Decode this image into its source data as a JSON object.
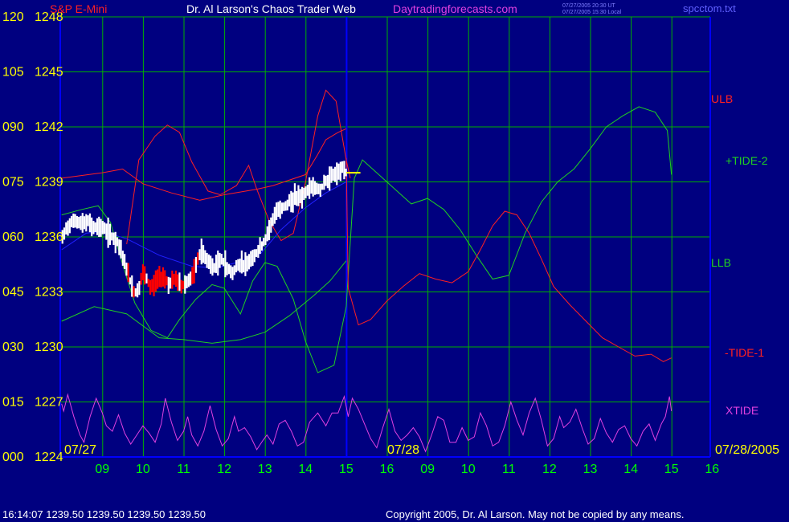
{
  "header": {
    "instrument": "S&P E-Mini",
    "title": "Dr. Al Larson's Chaos Trader Web",
    "site": "Daytradingforecasts.com",
    "stamp_ut": "07/27/2005 20:30 UT",
    "stamp_local": "07/27/2005 15:30 Local",
    "file": "spcctom.txt"
  },
  "footer": {
    "status": "16:14:07  1239.50 1239.50 1239.50 1239.50",
    "copyright": "Copyright 2005, Dr. Al Larson. May not be copied by any means."
  },
  "colors": {
    "background": "#000080",
    "grid": "#00b000",
    "axis": "#0000ff",
    "price_bar": "#ffffff",
    "price_bar_low": "#ff0000",
    "ulb": "#ff2020",
    "llb": "#20d020",
    "tide_plus": "#20d020",
    "tide_minus": "#ff2020",
    "xtide": "#e040e0",
    "moving_avg": "#2020ff",
    "yellow": "#ffff00"
  },
  "chart_data": {
    "type": "line",
    "y_left_labels": [
      "120",
      "105",
      "090",
      "075",
      "060",
      "045",
      "030",
      "015",
      "000"
    ],
    "y_price_labels": [
      "1248",
      "1245",
      "1242",
      "1239",
      "1236",
      "1233",
      "1230",
      "1227",
      "1224"
    ],
    "ylim_price": [
      1224,
      1248
    ],
    "x_hour_labels": [
      "09",
      "10",
      "11",
      "12",
      "13",
      "14",
      "15",
      "16",
      "09",
      "10",
      "11",
      "12",
      "13",
      "14",
      "15",
      "16"
    ],
    "date_labels": [
      "07/27",
      "07/28",
      "07/28/2005"
    ],
    "series_labels": {
      "ulb": "ULB",
      "tide_plus": "+TIDE-2",
      "llb": "LLB",
      "tide_minus": "-TIDE-1",
      "xtide": "XTIDE"
    },
    "last_price": 1239.5,
    "ulb": [
      [
        0,
        1239.2
      ],
      [
        1,
        1239.5
      ],
      [
        1.5,
        1239.7
      ],
      [
        2,
        1238.9
      ],
      [
        2.7,
        1238.4
      ],
      [
        3.4,
        1238.0
      ],
      [
        4,
        1238.3
      ],
      [
        4.8,
        1238.6
      ],
      [
        5.2,
        1238.8
      ],
      [
        6,
        1239.4
      ],
      [
        6.3,
        1240.5
      ],
      [
        6.5,
        1241.3
      ],
      [
        6.8,
        1241.7
      ],
      [
        7,
        1241.9
      ]
    ],
    "ulb_upper": [
      [
        1.6,
        1235.6
      ],
      [
        1.9,
        1240.2
      ],
      [
        2.3,
        1241.5
      ],
      [
        2.6,
        1242.1
      ],
      [
        2.9,
        1241.7
      ],
      [
        3.2,
        1240.1
      ],
      [
        3.6,
        1238.5
      ],
      [
        3.9,
        1238.3
      ],
      [
        4.3,
        1238.8
      ],
      [
        4.6,
        1239.9
      ],
      [
        4.8,
        1238.6
      ],
      [
        5.1,
        1236.9
      ],
      [
        5.4,
        1235.8
      ],
      [
        5.7,
        1236.2
      ],
      [
        6,
        1239.0
      ],
      [
        6.3,
        1242.6
      ],
      [
        6.5,
        1244.0
      ],
      [
        6.75,
        1243.4
      ],
      [
        7,
        1240.2
      ],
      [
        7.1,
        1239.2
      ]
    ],
    "llb": [
      [
        0,
        1231.4
      ],
      [
        0.8,
        1232.2
      ],
      [
        1.6,
        1231.8
      ],
      [
        2.4,
        1230.5
      ],
      [
        3,
        1230.4
      ],
      [
        3.7,
        1230.2
      ],
      [
        4.4,
        1230.4
      ],
      [
        5,
        1230.8
      ],
      [
        5.6,
        1231.7
      ],
      [
        6.2,
        1232.8
      ],
      [
        6.6,
        1233.6
      ],
      [
        7,
        1234.7
      ]
    ],
    "tide_plus": [
      [
        0,
        1237.2
      ],
      [
        0.5,
        1237.5
      ],
      [
        0.9,
        1237.7
      ],
      [
        1.2,
        1236.8
      ],
      [
        1.5,
        1234.5
      ],
      [
        1.8,
        1232.4
      ],
      [
        2.2,
        1230.9
      ],
      [
        2.6,
        1230.5
      ],
      [
        2.9,
        1231.5
      ],
      [
        3.3,
        1232.6
      ],
      [
        3.7,
        1233.4
      ],
      [
        4,
        1233.2
      ],
      [
        4.4,
        1231.8
      ],
      [
        4.7,
        1233.6
      ],
      [
        5,
        1234.6
      ],
      [
        5.3,
        1234.4
      ],
      [
        5.7,
        1232.6
      ],
      [
        6,
        1230.3
      ],
      [
        6.3,
        1228.6
      ],
      [
        6.7,
        1229.0
      ],
      [
        7,
        1232.2
      ],
      [
        7.2,
        1239.2
      ],
      [
        7.4,
        1240.2
      ],
      [
        7.8,
        1239.4
      ],
      [
        8.2,
        1238.6
      ],
      [
        8.6,
        1237.8
      ],
      [
        9,
        1238.1
      ],
      [
        9.4,
        1237.5
      ],
      [
        9.8,
        1236.4
      ],
      [
        10.2,
        1235.0
      ],
      [
        10.6,
        1233.7
      ],
      [
        11,
        1233.9
      ],
      [
        11.4,
        1236.2
      ],
      [
        11.8,
        1237.9
      ],
      [
        12.2,
        1239.0
      ],
      [
        12.6,
        1239.7
      ],
      [
        13,
        1240.8
      ],
      [
        13.4,
        1242.0
      ],
      [
        13.8,
        1242.6
      ],
      [
        14.2,
        1243.1
      ],
      [
        14.6,
        1242.8
      ],
      [
        14.9,
        1241.8
      ],
      [
        15,
        1239.4
      ]
    ],
    "tide_minus": [
      [
        7,
        1240.3
      ],
      [
        7.05,
        1233.2
      ],
      [
        7.3,
        1231.2
      ],
      [
        7.6,
        1231.5
      ],
      [
        8,
        1232.5
      ],
      [
        8.4,
        1233.3
      ],
      [
        8.8,
        1234.0
      ],
      [
        9.2,
        1233.7
      ],
      [
        9.6,
        1233.5
      ],
      [
        10,
        1234.1
      ],
      [
        10.3,
        1235.3
      ],
      [
        10.6,
        1236.6
      ],
      [
        10.9,
        1237.4
      ],
      [
        11.2,
        1237.2
      ],
      [
        11.5,
        1236.2
      ],
      [
        11.8,
        1234.8
      ],
      [
        12.1,
        1233.3
      ],
      [
        12.5,
        1232.3
      ],
      [
        12.9,
        1231.4
      ],
      [
        13.3,
        1230.5
      ],
      [
        13.7,
        1230.0
      ],
      [
        14.1,
        1229.5
      ],
      [
        14.5,
        1229.6
      ],
      [
        14.8,
        1229.2
      ],
      [
        15,
        1229.4
      ]
    ],
    "moving_avg": [
      [
        0,
        1235.3
      ],
      [
        0.6,
        1236.2
      ],
      [
        1,
        1236.3
      ],
      [
        1.6,
        1235.9
      ],
      [
        2.4,
        1235.0
      ],
      [
        3.2,
        1234.4
      ],
      [
        3.8,
        1234.3
      ],
      [
        4.3,
        1234.6
      ],
      [
        4.9,
        1235.1
      ],
      [
        5.4,
        1236.4
      ],
      [
        6,
        1237.6
      ],
      [
        6.5,
        1238.4
      ],
      [
        7,
        1239.0
      ]
    ],
    "price_path": [
      [
        0,
        1235.8
      ],
      [
        0.1,
        1236.4
      ],
      [
        0.2,
        1236.7
      ],
      [
        0.35,
        1236.9
      ],
      [
        0.5,
        1236.7
      ],
      [
        0.65,
        1236.8
      ],
      [
        0.8,
        1236.5
      ],
      [
        0.95,
        1236.6
      ],
      [
        1.1,
        1236.3
      ],
      [
        1.25,
        1236.0
      ],
      [
        1.4,
        1235.7
      ],
      [
        1.5,
        1235.0
      ],
      [
        1.6,
        1234.2
      ],
      [
        1.7,
        1233.5
      ],
      [
        1.8,
        1232.9
      ],
      [
        1.9,
        1233.2
      ],
      [
        2,
        1234.0
      ],
      [
        2.1,
        1233.6
      ],
      [
        2.2,
        1233.2
      ],
      [
        2.35,
        1233.7
      ],
      [
        2.5,
        1233.9
      ],
      [
        2.65,
        1233.4
      ],
      [
        2.8,
        1233.7
      ],
      [
        2.95,
        1233.3
      ],
      [
        3.1,
        1233.6
      ],
      [
        3.25,
        1233.9
      ],
      [
        3.35,
        1234.8
      ],
      [
        3.45,
        1235.3
      ],
      [
        3.6,
        1234.6
      ],
      [
        3.75,
        1234.3
      ],
      [
        3.9,
        1234.9
      ],
      [
        4.05,
        1234.4
      ],
      [
        4.2,
        1234.0
      ],
      [
        4.35,
        1234.5
      ],
      [
        4.5,
        1234.4
      ],
      [
        4.65,
        1234.9
      ],
      [
        4.8,
        1235.1
      ],
      [
        4.95,
        1235.6
      ],
      [
        5.1,
        1236.3
      ],
      [
        5.2,
        1236.9
      ],
      [
        5.3,
        1237.6
      ],
      [
        5.45,
        1237.6
      ],
      [
        5.6,
        1237.9
      ],
      [
        5.75,
        1238.2
      ],
      [
        5.9,
        1238.1
      ],
      [
        6.05,
        1238.5
      ],
      [
        6.2,
        1238.7
      ],
      [
        6.35,
        1238.6
      ],
      [
        6.5,
        1239.0
      ],
      [
        6.65,
        1239.4
      ],
      [
        6.8,
        1239.5
      ],
      [
        6.9,
        1239.8
      ],
      [
        7,
        1239.5
      ]
    ],
    "red_segment_range": [
      1.6,
      3.4
    ],
    "xtide": [
      [
        0,
        1226.9
      ],
      [
        0.05,
        1226.5
      ],
      [
        0.15,
        1227.4
      ],
      [
        0.3,
        1226.2
      ],
      [
        0.45,
        1225.2
      ],
      [
        0.55,
        1224.8
      ],
      [
        0.7,
        1226.2
      ],
      [
        0.85,
        1227.2
      ],
      [
        1.0,
        1226.4
      ],
      [
        1.1,
        1225.7
      ],
      [
        1.25,
        1225.4
      ],
      [
        1.4,
        1226.3
      ],
      [
        1.55,
        1225.3
      ],
      [
        1.7,
        1224.7
      ],
      [
        1.85,
        1225.2
      ],
      [
        2.0,
        1225.7
      ],
      [
        2.15,
        1225.3
      ],
      [
        2.3,
        1224.8
      ],
      [
        2.45,
        1225.8
      ],
      [
        2.55,
        1227.2
      ],
      [
        2.7,
        1225.9
      ],
      [
        2.85,
        1224.9
      ],
      [
        3.0,
        1225.4
      ],
      [
        3.1,
        1226.2
      ],
      [
        3.2,
        1225.2
      ],
      [
        3.35,
        1224.6
      ],
      [
        3.5,
        1225.4
      ],
      [
        3.65,
        1226.8
      ],
      [
        3.8,
        1225.5
      ],
      [
        3.95,
        1224.6
      ],
      [
        4.1,
        1225.0
      ],
      [
        4.25,
        1226.2
      ],
      [
        4.35,
        1225.4
      ],
      [
        4.5,
        1225.6
      ],
      [
        4.65,
        1225.1
      ],
      [
        4.8,
        1224.4
      ],
      [
        4.95,
        1224.9
      ],
      [
        5.05,
        1225.2
      ],
      [
        5.2,
        1224.7
      ],
      [
        5.35,
        1225.8
      ],
      [
        5.5,
        1226.0
      ],
      [
        5.65,
        1225.4
      ],
      [
        5.8,
        1224.6
      ],
      [
        5.95,
        1224.8
      ],
      [
        6.1,
        1225.9
      ],
      [
        6.3,
        1226.4
      ],
      [
        6.5,
        1225.7
      ],
      [
        6.65,
        1226.4
      ],
      [
        6.8,
        1226.4
      ],
      [
        6.95,
        1227.3
      ],
      [
        7.05,
        1226.2
      ],
      [
        7.15,
        1227.2
      ],
      [
        7.3,
        1226.6
      ],
      [
        7.45,
        1225.8
      ],
      [
        7.6,
        1225.0
      ],
      [
        7.75,
        1224.5
      ],
      [
        7.9,
        1225.6
      ],
      [
        8.05,
        1226.6
      ],
      [
        8.2,
        1225.4
      ],
      [
        8.35,
        1224.9
      ],
      [
        8.5,
        1225.2
      ],
      [
        8.65,
        1225.6
      ],
      [
        8.8,
        1225.1
      ],
      [
        8.95,
        1224.3
      ],
      [
        9.1,
        1225.2
      ],
      [
        9.25,
        1226.2
      ],
      [
        9.4,
        1226.0
      ],
      [
        9.55,
        1224.8
      ],
      [
        9.7,
        1224.8
      ],
      [
        9.85,
        1225.6
      ],
      [
        10.0,
        1224.9
      ],
      [
        10.15,
        1225.1
      ],
      [
        10.3,
        1226.4
      ],
      [
        10.45,
        1225.7
      ],
      [
        10.6,
        1224.6
      ],
      [
        10.75,
        1224.8
      ],
      [
        10.9,
        1225.7
      ],
      [
        11.05,
        1227.0
      ],
      [
        11.2,
        1226.0
      ],
      [
        11.35,
        1225.2
      ],
      [
        11.5,
        1226.4
      ],
      [
        11.65,
        1227.2
      ],
      [
        11.8,
        1226.0
      ],
      [
        11.95,
        1224.6
      ],
      [
        12.1,
        1225.0
      ],
      [
        12.25,
        1226.2
      ],
      [
        12.35,
        1225.6
      ],
      [
        12.5,
        1225.9
      ],
      [
        12.65,
        1226.6
      ],
      [
        12.8,
        1225.6
      ],
      [
        12.95,
        1224.7
      ],
      [
        13.1,
        1225.0
      ],
      [
        13.25,
        1226.1
      ],
      [
        13.4,
        1225.3
      ],
      [
        13.55,
        1224.8
      ],
      [
        13.7,
        1225.5
      ],
      [
        13.85,
        1225.7
      ],
      [
        14.0,
        1225.0
      ],
      [
        14.15,
        1224.6
      ],
      [
        14.3,
        1225.4
      ],
      [
        14.45,
        1225.8
      ],
      [
        14.6,
        1224.9
      ],
      [
        14.75,
        1225.8
      ],
      [
        14.85,
        1226.2
      ],
      [
        14.95,
        1227.3
      ],
      [
        15,
        1226.5
      ]
    ]
  }
}
